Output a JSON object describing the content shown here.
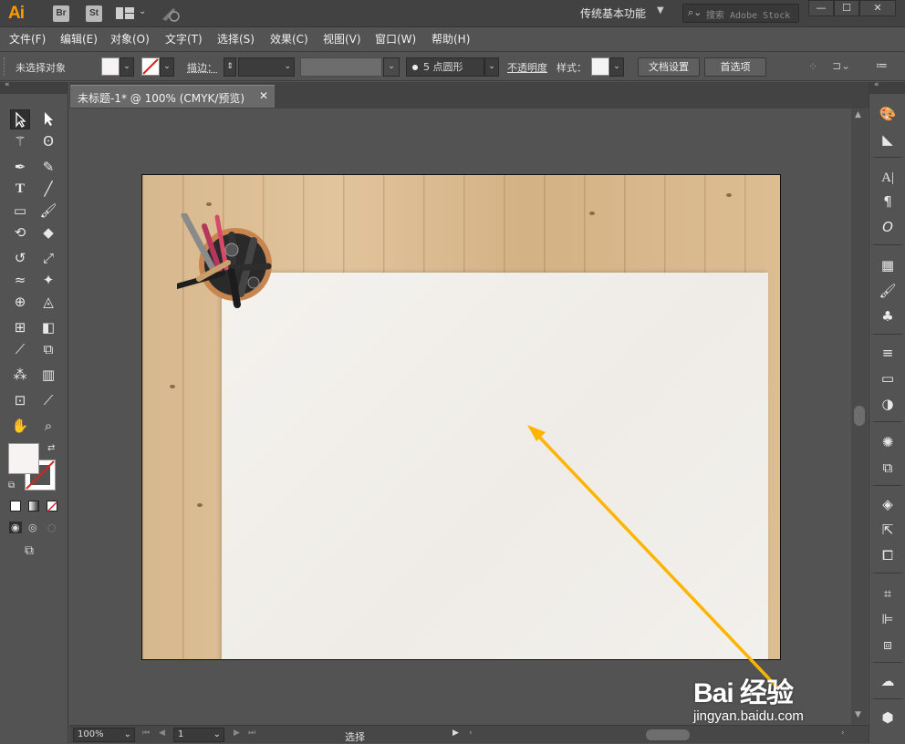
{
  "app": {
    "logo": "Ai",
    "badges": [
      "Br",
      "St"
    ],
    "workspace": "传统基本功能",
    "stock_search_placeholder": "搜索 Adobe Stock",
    "window_controls": [
      "—",
      "☐",
      "✕"
    ]
  },
  "menu": [
    "文件(F)",
    "编辑(E)",
    "对象(O)",
    "文字(T)",
    "选择(S)",
    "效果(C)",
    "视图(V)",
    "窗口(W)",
    "帮助(H)"
  ],
  "control_bar": {
    "selection_status": "未选择对象",
    "stroke_label": "描边：",
    "brush_point": "5 点圆形",
    "opacity_label": "不透明度",
    "style_label": "样式：",
    "doc_settings_button": "文档设置",
    "preferences_button": "首选项"
  },
  "document": {
    "tab_title": "未标题-1* @ 100% (CMYK/预览)",
    "tab_close": "✕"
  },
  "status_bar": {
    "zoom": "100%",
    "page": "1",
    "tool_status": "选择"
  },
  "colors": {
    "accent": "#ff9a00",
    "arrow": "#ffb400",
    "ui_bg": "#535353",
    "paper": "#f2f0ec",
    "wood": "#dcbd92"
  },
  "watermark": {
    "main": "Bai 经验",
    "sub": "jingyan.baidu.com"
  }
}
